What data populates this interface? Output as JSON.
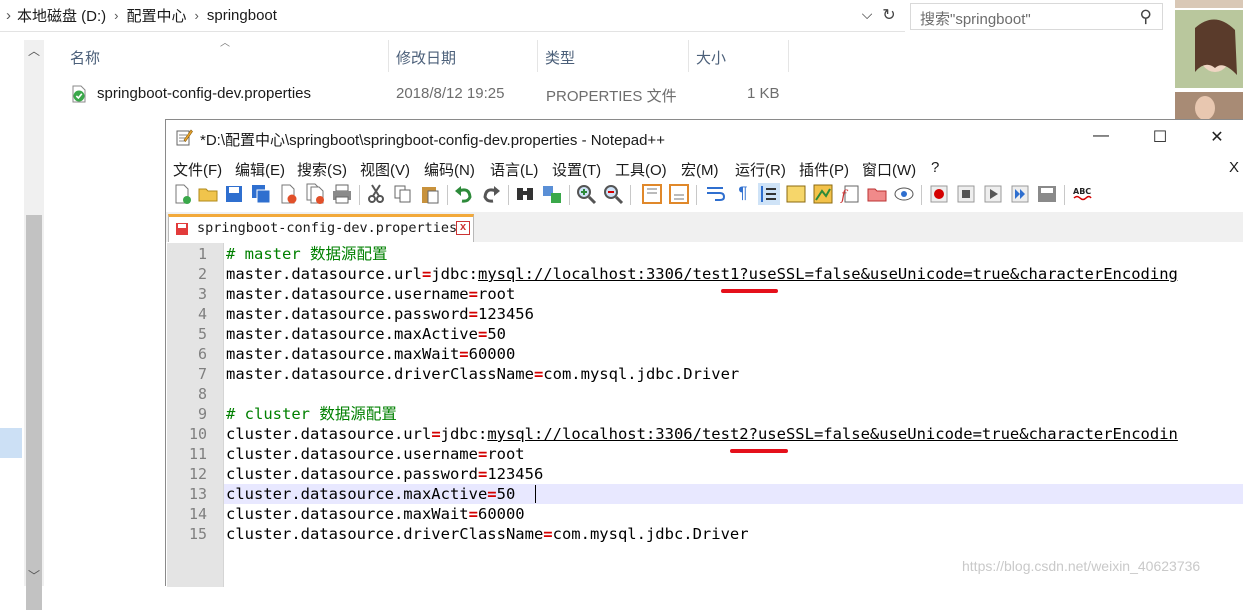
{
  "explorer": {
    "breadcrumb": [
      "本地磁盘 (D:)",
      "配置中心",
      "springboot"
    ],
    "breadcrumb_sep": "›",
    "search_placeholder": "搜索\"springboot\"",
    "columns": {
      "name": "名称",
      "modified": "修改日期",
      "type": "类型",
      "size": "大小"
    },
    "file": {
      "name": "springboot-config-dev.properties",
      "modified": "2018/8/12 19:25",
      "type": "PROPERTIES 文件",
      "size": "1 KB"
    }
  },
  "notepad": {
    "title": "*D:\\配置中心\\springboot\\springboot-config-dev.properties - Notepad++",
    "menu": [
      "文件(F)",
      "编辑(E)",
      "搜索(S)",
      "视图(V)",
      "编码(N)",
      "语言(L)",
      "设置(T)",
      "工具(O)",
      "宏(M)",
      "运行(R)",
      "插件(P)",
      "窗口(W)",
      "?"
    ],
    "menu_close": "X",
    "tab_label": "springboot-config-dev.properties",
    "tab_close": "x",
    "line_numbers": [
      "1",
      "2",
      "3",
      "4",
      "5",
      "6",
      "7",
      "8",
      "9",
      "10",
      "11",
      "12",
      "13",
      "14",
      "15"
    ],
    "lines": [
      {
        "kind": "comment",
        "text": "# master 数据源配置"
      },
      {
        "kind": "kv",
        "key": "master.datasource.url",
        "pre": "jdbc:",
        "url": "mysql://localhost:3306/test1?useSSL=false&useUnicode=true&characterEncoding"
      },
      {
        "kind": "kv",
        "key": "master.datasource.username",
        "value": "root"
      },
      {
        "kind": "kv",
        "key": "master.datasource.password",
        "value": "123456"
      },
      {
        "kind": "kv",
        "key": "master.datasource.maxActive",
        "value": "50"
      },
      {
        "kind": "kv",
        "key": "master.datasource.maxWait",
        "value": "60000"
      },
      {
        "kind": "kv",
        "key": "master.datasource.driverClassName",
        "value": "com.mysql.jdbc.Driver"
      },
      {
        "kind": "blank"
      },
      {
        "kind": "comment",
        "text": "# cluster 数据源配置"
      },
      {
        "kind": "kv",
        "key": "cluster.datasource.url",
        "pre": "jdbc:",
        "url": "mysql://localhost:3306/test2?useSSL=false&useUnicode=true&characterEncodin"
      },
      {
        "kind": "kv",
        "key": "cluster.datasource.username",
        "value": "root"
      },
      {
        "kind": "kv",
        "key": "cluster.datasource.password",
        "value": "123456"
      },
      {
        "kind": "kv",
        "key": "cluster.datasource.maxActive",
        "value": "50"
      },
      {
        "kind": "kv",
        "key": "cluster.datasource.maxWait",
        "value": "60000"
      },
      {
        "kind": "kv",
        "key": "cluster.datasource.driverClassName",
        "value": "com.mysql.jdbc.Driver"
      }
    ],
    "current_line": 13,
    "colors": {
      "equals": "#d40000",
      "comment": "#008000",
      "annotation": "#e5101b",
      "tab_accent": "#f2a93b"
    }
  },
  "watermark": "https://blog.csdn.net/weixin_40623736"
}
